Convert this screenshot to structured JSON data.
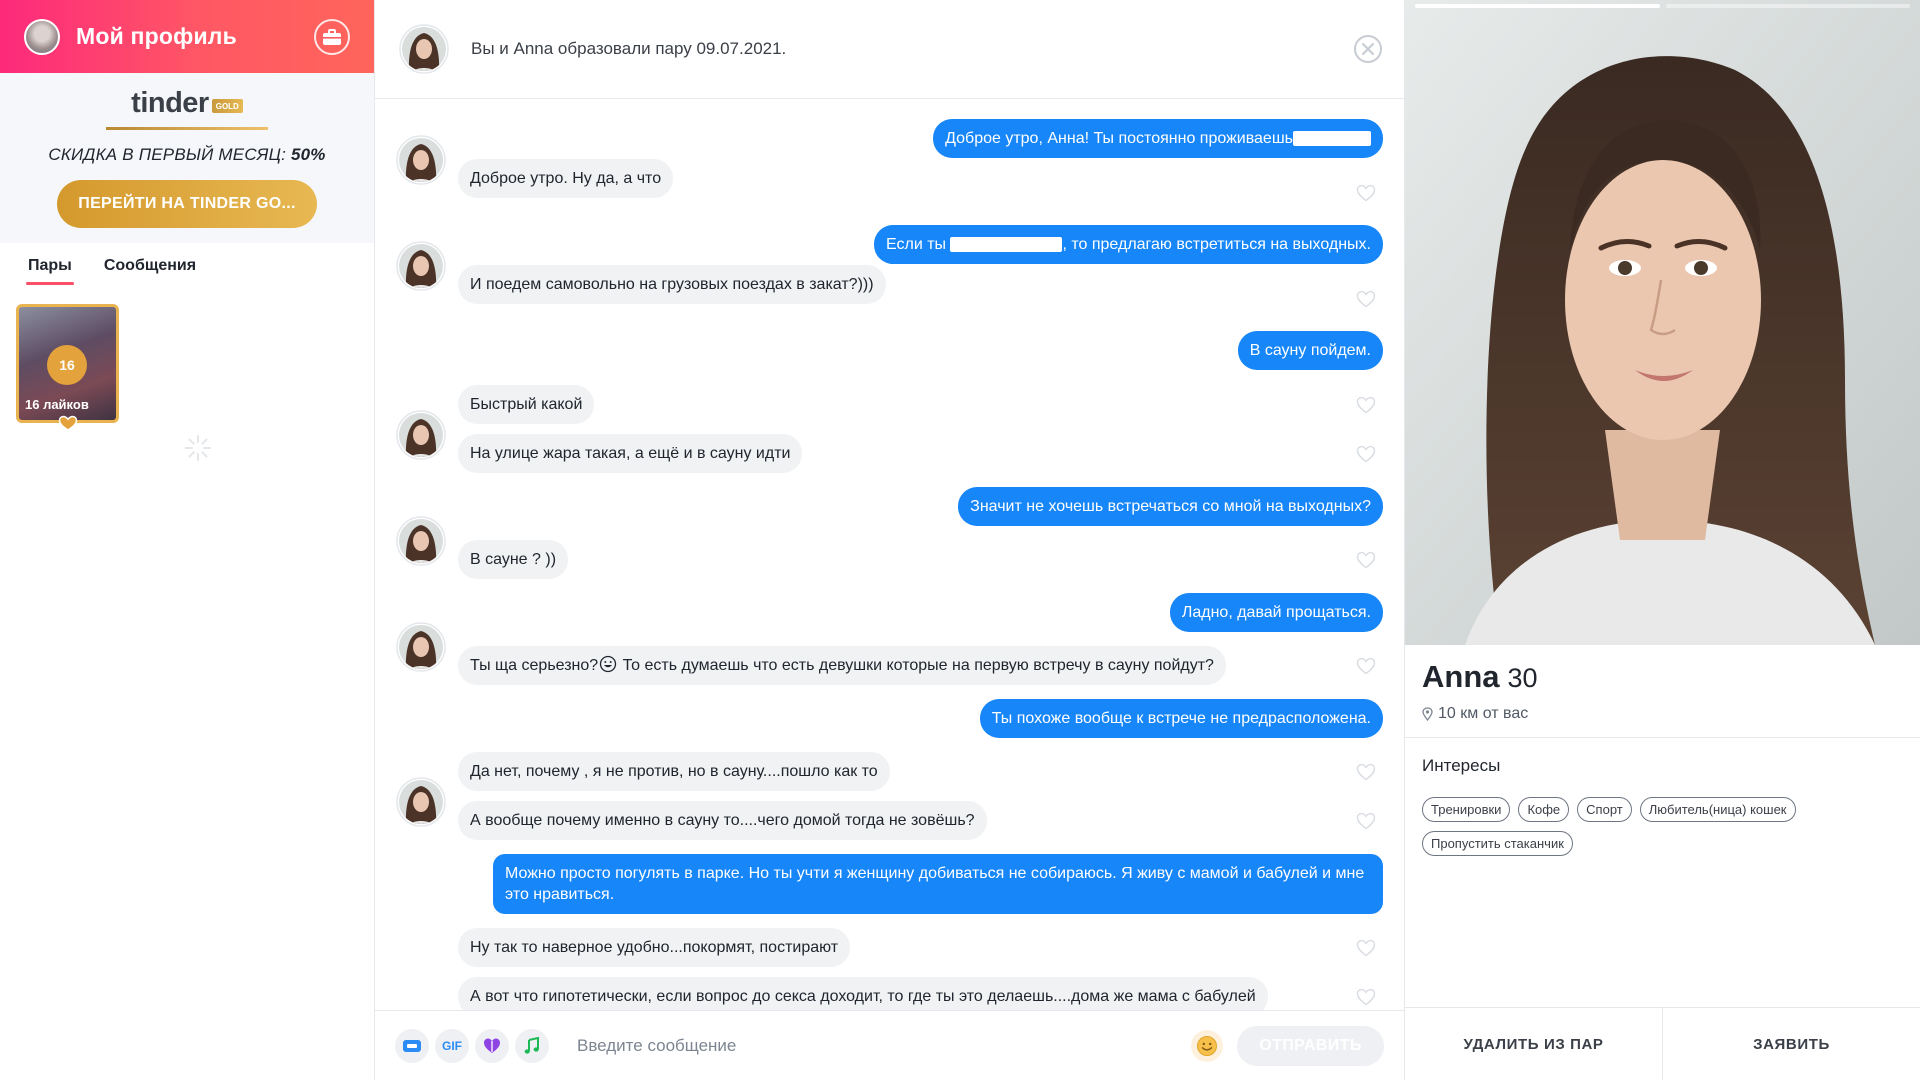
{
  "sidebar": {
    "profile_title": "Мой профиль",
    "gold": {
      "logo_word": "tinder",
      "logo_badge": "GOLD",
      "discount_prefix": "СКИДКА В ПЕРВЫЙ МЕСЯЦ:",
      "discount_value": "50%",
      "cta_label": "ПЕРЕЙТИ НА TINDER GO..."
    },
    "tabs": [
      {
        "label": "Пары",
        "active": true
      },
      {
        "label": "Сообщения",
        "active": false
      }
    ],
    "likes": {
      "count": "16",
      "caption": "16 лайков"
    }
  },
  "chat": {
    "header_text": "Вы и Anna образовали пару 09.07.2021.",
    "messages": [
      {
        "from": "me",
        "text": "Доброе утро, Анна! Ты постоянно проживаешь"
      },
      {
        "from": "match",
        "text": "Доброе утро. Ну да, а что"
      },
      {
        "from": "me",
        "text_before": "Если ты",
        "text_after": ", то предлагаю встретиться на выходных."
      },
      {
        "from": "match",
        "text": "И поедем самовольно на грузовых поездах в закат?)))"
      },
      {
        "from": "me",
        "text": "В сауну пойдем."
      },
      {
        "from": "match",
        "text": "Быстрый какой"
      },
      {
        "from": "match",
        "text": "На улице жара такая, а ещё и в сауну идти"
      },
      {
        "from": "me",
        "text": "Значит не хочешь встречаться со мной на выходных?"
      },
      {
        "from": "match",
        "text": "В сауне ? ))"
      },
      {
        "from": "me",
        "text": "Ладно, давай прощаться."
      },
      {
        "from": "match",
        "text_before": "Ты ща серьезно?",
        "text_after": " То есть думаешь что есть девушки которые на первую встречу в сауну пойдут?"
      },
      {
        "from": "me",
        "text": "Ты похоже вообще к встрече не предрасположена."
      },
      {
        "from": "match",
        "text": "Да нет, почему , я не против, но в сауну....пошло как то"
      },
      {
        "from": "match",
        "text": "А вообще почему именно в сауну то....чего домой тогда не зовёшь?"
      },
      {
        "from": "me",
        "text": "Можно просто погулять в парке. Но ты учти я женщину добиваться не собираюсь. Я живу с мамой и бабулей и мне это нравиться."
      },
      {
        "from": "match",
        "text": "Ну так то наверное удобно...покормят, постирают"
      },
      {
        "from": "match",
        "text": "А вот что гипотетически, если вопрос до секса доходит, то где ты это делаешь....дома же мама с бабулей"
      }
    ],
    "composer": {
      "gif_label": "GIF",
      "placeholder": "Введите сообщение",
      "send_label": "ОТПРАВИТЬ"
    }
  },
  "profile": {
    "name": "Anna",
    "age": "30",
    "distance": "10 км от вас",
    "interests_title": "Интересы",
    "interests": [
      "Тренировки",
      "Кофе",
      "Спорт",
      "Любитель(ница) кошек",
      "Пропустить стаканчик"
    ],
    "photo_count": 2,
    "photo_current": 1,
    "actions": {
      "unmatch": "УДАЛИТЬ ИЗ ПАР",
      "report": "ЗАЯВИТЬ"
    }
  },
  "colors": {
    "brand_gradient_start": "#fd297b",
    "brand_gradient_end": "#ff655b",
    "gold": "#e2a63a",
    "my_bubble": "#1786f8",
    "match_bubble": "#f0f2f4"
  }
}
